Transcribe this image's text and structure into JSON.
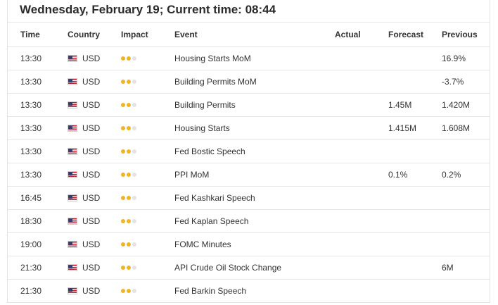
{
  "title": "Wednesday, February 19; Current time: 08:44",
  "columns": {
    "time": "Time",
    "country": "Country",
    "impact": "Impact",
    "event": "Event",
    "actual": "Actual",
    "forecast": "Forecast",
    "previous": "Previous"
  },
  "colors": {
    "impact_on": "#f0b429",
    "impact_off": "#e4e4e4",
    "flag_icon": "us-flag-icon"
  },
  "rows": [
    {
      "time": "13:30",
      "country": "USD",
      "impact": 2,
      "event": "Housing Starts MoM",
      "actual": "",
      "forecast": "",
      "previous": "16.9%"
    },
    {
      "time": "13:30",
      "country": "USD",
      "impact": 2,
      "event": "Building Permits MoM",
      "actual": "",
      "forecast": "",
      "previous": "-3.7%"
    },
    {
      "time": "13:30",
      "country": "USD",
      "impact": 2,
      "event": "Building Permits",
      "actual": "",
      "forecast": "1.45M",
      "previous": "1.420M"
    },
    {
      "time": "13:30",
      "country": "USD",
      "impact": 2,
      "event": "Housing Starts",
      "actual": "",
      "forecast": "1.415M",
      "previous": "1.608M"
    },
    {
      "time": "13:30",
      "country": "USD",
      "impact": 2,
      "event": "Fed Bostic Speech",
      "actual": "",
      "forecast": "",
      "previous": ""
    },
    {
      "time": "13:30",
      "country": "USD",
      "impact": 2,
      "event": "PPI MoM",
      "actual": "",
      "forecast": "0.1%",
      "previous": "0.2%"
    },
    {
      "time": "16:45",
      "country": "USD",
      "impact": 2,
      "event": "Fed Kashkari Speech",
      "actual": "",
      "forecast": "",
      "previous": ""
    },
    {
      "time": "18:30",
      "country": "USD",
      "impact": 2,
      "event": "Fed Kaplan Speech",
      "actual": "",
      "forecast": "",
      "previous": ""
    },
    {
      "time": "19:00",
      "country": "USD",
      "impact": 2,
      "event": "FOMC Minutes",
      "actual": "",
      "forecast": "",
      "previous": ""
    },
    {
      "time": "21:30",
      "country": "USD",
      "impact": 2,
      "event": "API Crude Oil Stock Change",
      "actual": "",
      "forecast": "",
      "previous": "6M"
    },
    {
      "time": "21:30",
      "country": "USD",
      "impact": 2,
      "event": "Fed Barkin Speech",
      "actual": "",
      "forecast": "",
      "previous": ""
    }
  ]
}
